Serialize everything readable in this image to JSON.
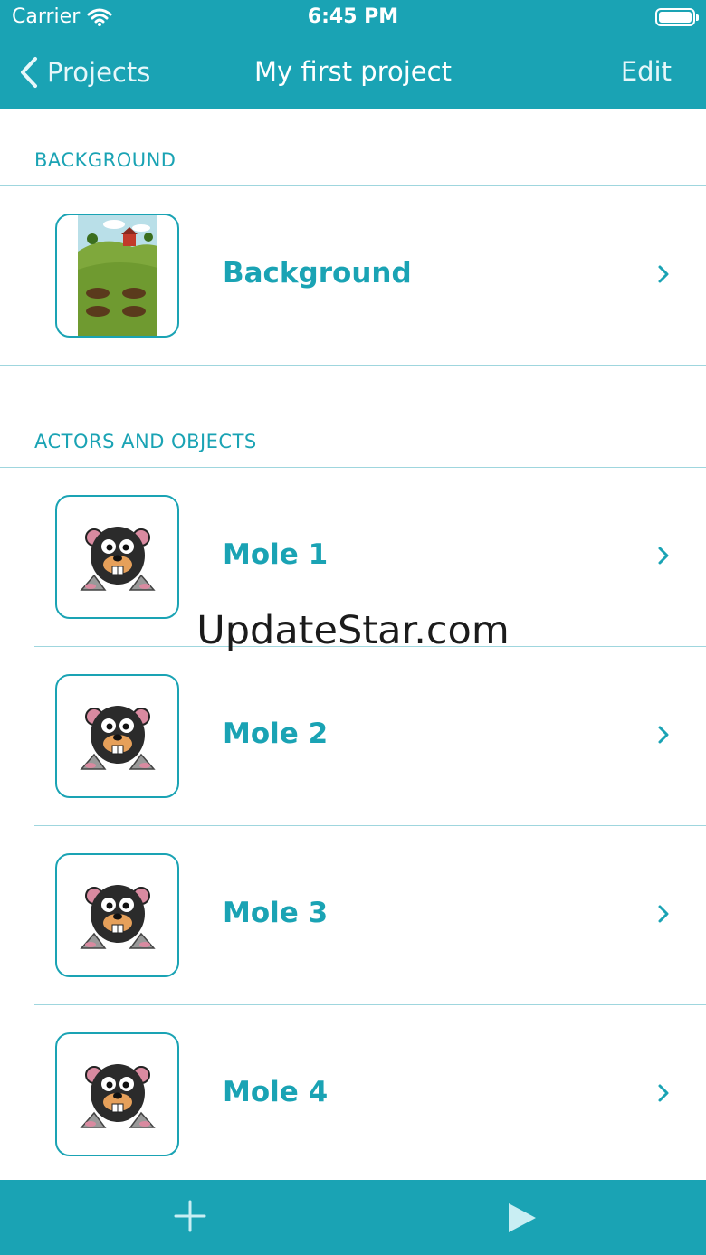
{
  "status_bar": {
    "carrier": "Carrier",
    "time": "6:45 PM"
  },
  "nav": {
    "back_label": "Projects",
    "title": "My first project",
    "edit_label": "Edit"
  },
  "sections": {
    "background_header": "BACKGROUND",
    "actors_header": "ACTORS AND OBJECTS"
  },
  "background_row": {
    "label": "Background"
  },
  "actors": [
    {
      "label": "Mole 1"
    },
    {
      "label": "Mole 2"
    },
    {
      "label": "Mole 3"
    },
    {
      "label": "Mole 4"
    }
  ],
  "watermark": "UpdateStar.com",
  "colors": {
    "accent": "#1aa3b4",
    "separator": "#9fd6de"
  },
  "icons": [
    "wifi-icon",
    "battery-icon",
    "back-chevron-icon",
    "chevron-right-icon",
    "add-icon",
    "play-icon"
  ]
}
